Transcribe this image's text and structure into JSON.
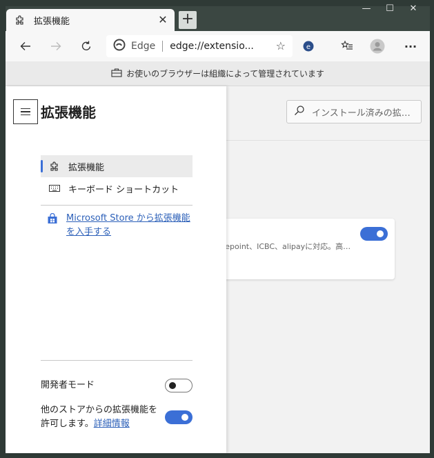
{
  "colors": {
    "accent": "#3b6fd6",
    "link": "#2b5fb8",
    "frame": "#2f3a36"
  },
  "tab": {
    "title": "拡張機能",
    "icon": "puzzle-icon",
    "close_label": "✕"
  },
  "newtab_label": "+",
  "window_controls": {
    "minimize": "—",
    "maximize": "☐",
    "close": "✕"
  },
  "address_bar": {
    "site_label": "Edge",
    "url": "edge://extensio...",
    "icons": [
      "edge-logo-icon",
      "star-icon"
    ]
  },
  "toolbar_icons": [
    "back-icon",
    "forward-icon",
    "refresh-icon",
    "extension-icon",
    "favorites-icon",
    "profile-icon",
    "more-icon"
  ],
  "more_label": "···",
  "managed_notice": "お使いのブラウザーは組織によって管理されています",
  "panel": {
    "title": "拡張機能",
    "nav": [
      {
        "label": "拡張機能",
        "icon": "puzzle-icon",
        "active": true
      },
      {
        "label": "キーボード ショートカット",
        "icon": "keyboard-icon",
        "active": false
      }
    ],
    "store_link": "Microsoft Store から拡張機能を入手する",
    "developer_mode": {
      "label": "開発者モード",
      "enabled": false
    },
    "other_stores": {
      "text": "他のストアからの拡張機能を許可します。",
      "link": "詳細情報",
      "enabled": true
    }
  },
  "search": {
    "placeholder": "インストール済みの拡…"
  },
  "extension_card": {
    "description": "repoint、ICBC、alipayに対応。高…",
    "enabled": true
  }
}
